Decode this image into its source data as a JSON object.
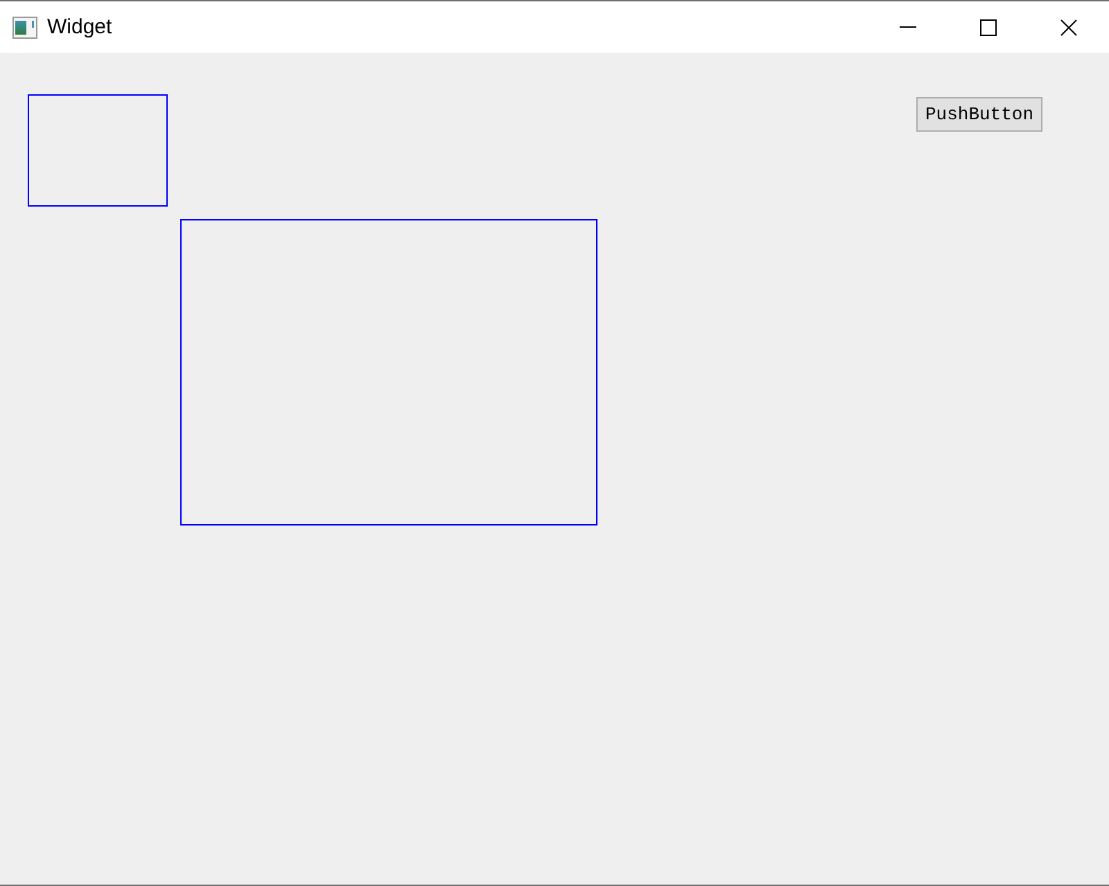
{
  "window": {
    "title": "Widget"
  },
  "push_button": {
    "label": "PushButton"
  }
}
